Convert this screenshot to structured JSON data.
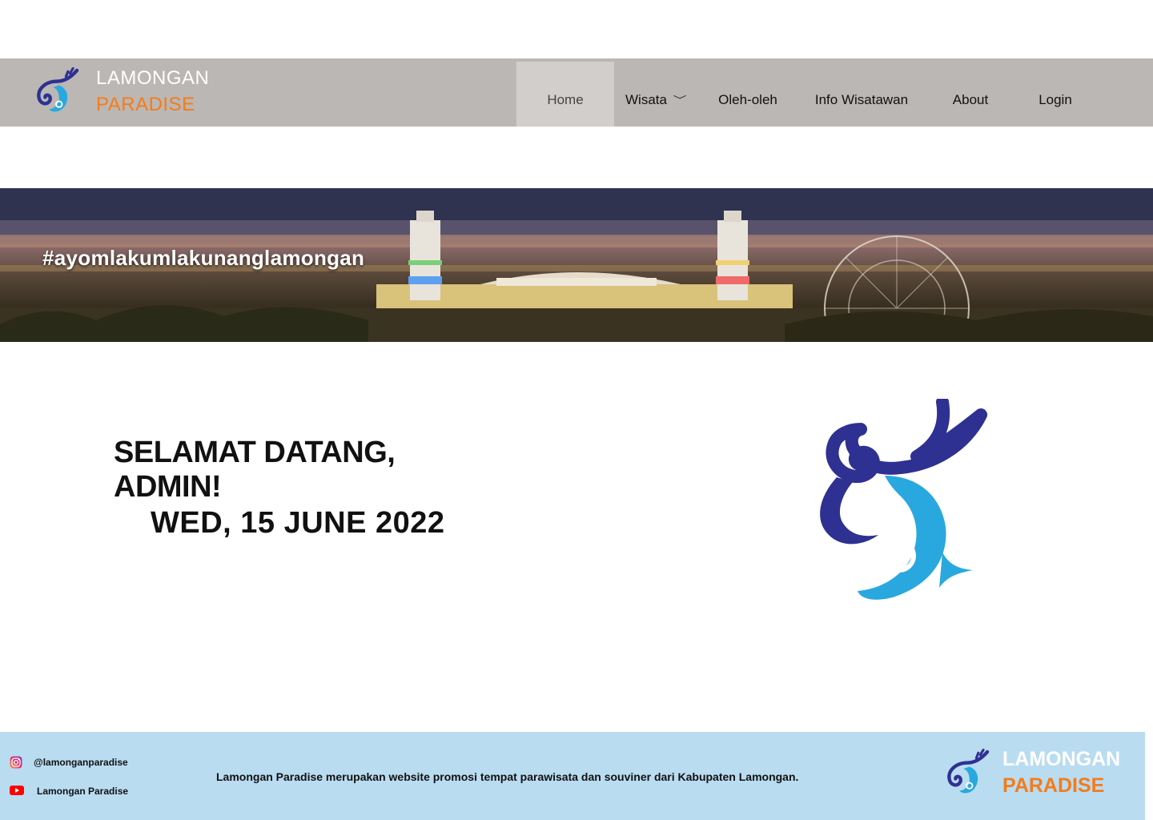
{
  "brand": {
    "line1": "LAMONGAN",
    "line2": "PARADISE",
    "logo_icon": "fish-logo-icon",
    "primary_color": "#2e3192",
    "secondary_color": "#29a8df",
    "accent_color": "#f47c1a"
  },
  "nav": {
    "items": [
      {
        "label": "Home",
        "active": true
      },
      {
        "label": "Wisata",
        "has_dropdown": true,
        "icon": "chevron-down-icon"
      },
      {
        "label": "Oleh-oleh"
      },
      {
        "label": "Info Wisatawan"
      },
      {
        "label": "About"
      },
      {
        "label": "Login"
      }
    ]
  },
  "banner": {
    "hashtag": "#ayomlakumlakunanglamongan"
  },
  "main": {
    "welcome": "SELAMAT DATANG, ADMIN!",
    "date": "WED, 15 JUNE 2022"
  },
  "footer": {
    "instagram": "@lamonganparadise",
    "youtube": "Lamongan Paradise",
    "description": "Lamongan Paradise merupakan website promosi tempat parawisata dan souviner dari Kabupaten Lamongan.",
    "brand_line1": "LAMONGAN",
    "brand_line2": "PARADISE",
    "background": "#b9dcf1"
  }
}
